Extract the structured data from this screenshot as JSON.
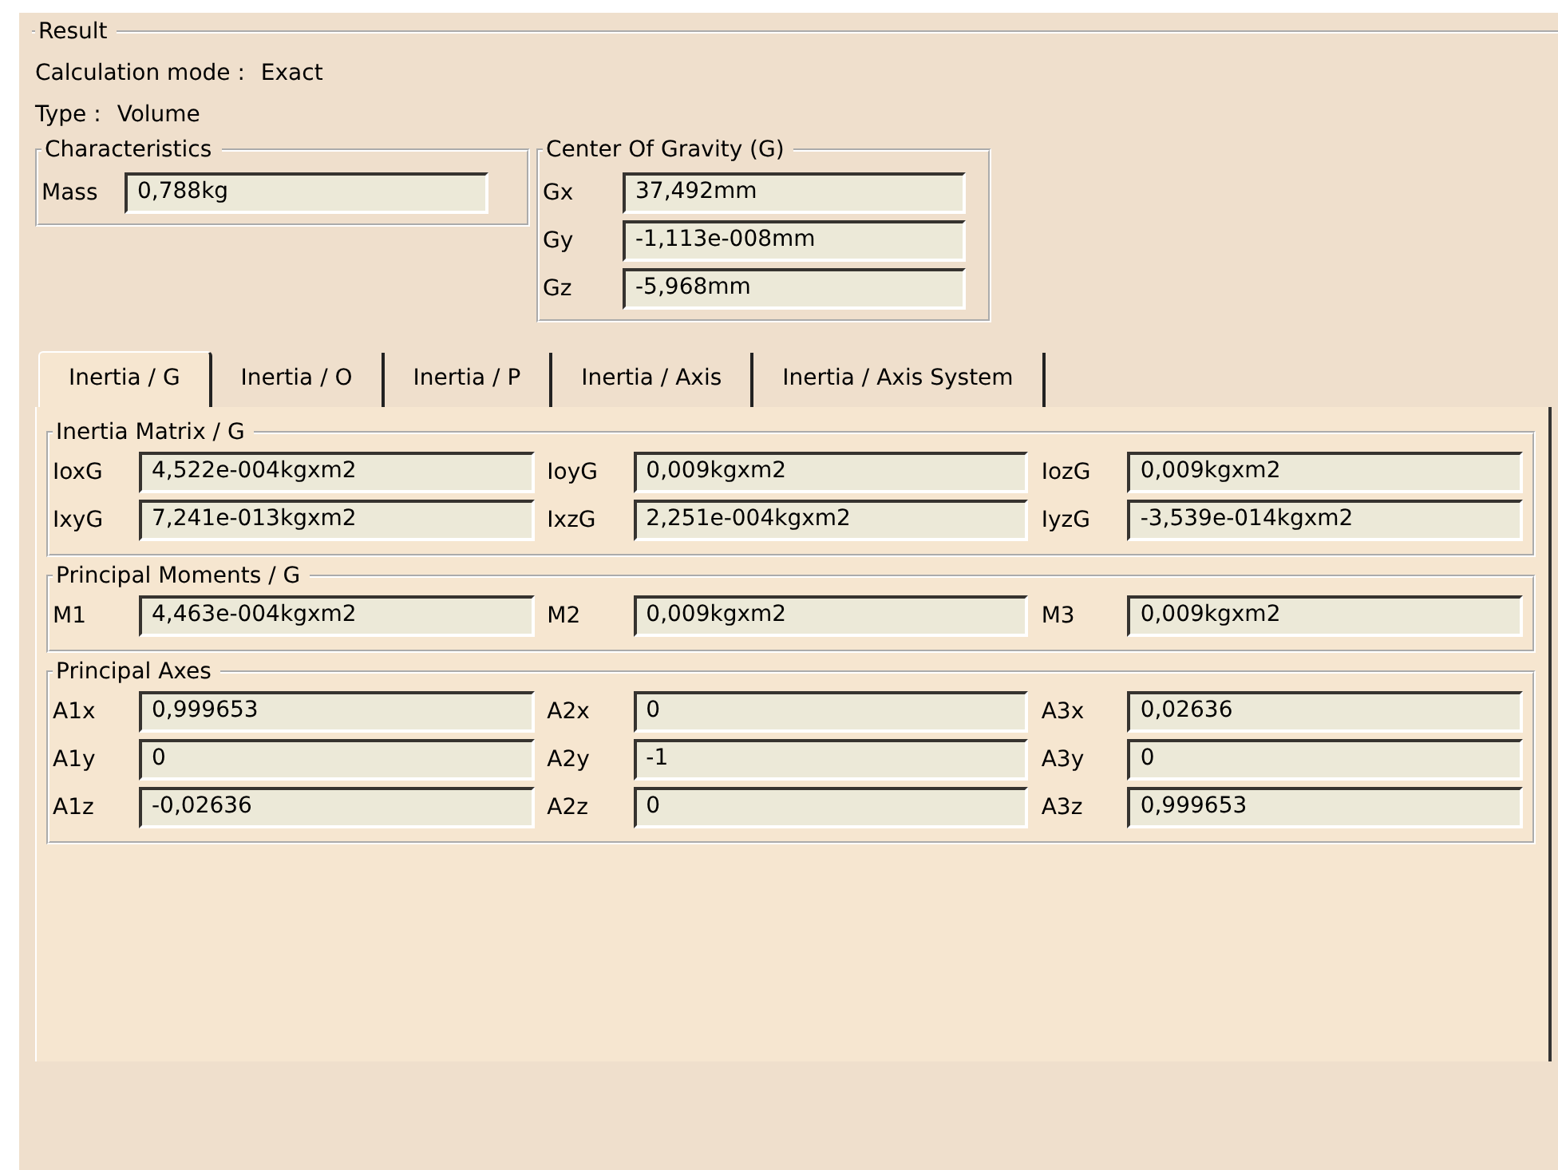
{
  "result": {
    "title": "Result",
    "lines": [
      {
        "label": "Calculation mode :",
        "value": "Exact"
      },
      {
        "label": "Type :",
        "value": "Volume"
      }
    ],
    "characteristics": {
      "title": "Characteristics",
      "fields": [
        {
          "label": "Mass",
          "value": "0,788kg"
        }
      ]
    },
    "center_of_gravity": {
      "title": "Center Of Gravity (G)",
      "fields": [
        {
          "label": "Gx",
          "value": "37,492mm"
        },
        {
          "label": "Gy",
          "value": "-1,113e-008mm"
        },
        {
          "label": "Gz",
          "value": "-5,968mm"
        }
      ]
    }
  },
  "tabs": [
    {
      "label": "Inertia / G",
      "selected": true
    },
    {
      "label": "Inertia / O",
      "selected": false
    },
    {
      "label": "Inertia / P",
      "selected": false
    },
    {
      "label": "Inertia / Axis",
      "selected": false
    },
    {
      "label": "Inertia / Axis System",
      "selected": false
    }
  ],
  "groups": [
    {
      "title": "Inertia Matrix / G",
      "rows": [
        [
          {
            "label": "IoxG",
            "value": "4,522e-004kgxm2"
          },
          {
            "label": "IoyG",
            "value": "0,009kgxm2"
          },
          {
            "label": "IozG",
            "value": "0,009kgxm2"
          }
        ],
        [
          {
            "label": "IxyG",
            "value": "7,241e-013kgxm2"
          },
          {
            "label": "IxzG",
            "value": "2,251e-004kgxm2"
          },
          {
            "label": "IyzG",
            "value": "-3,539e-014kgxm2"
          }
        ]
      ]
    },
    {
      "title": "Principal Moments / G",
      "rows": [
        [
          {
            "label": "M1",
            "value": "4,463e-004kgxm2"
          },
          {
            "label": "M2",
            "value": "0,009kgxm2"
          },
          {
            "label": "M3",
            "value": "0,009kgxm2"
          }
        ]
      ]
    },
    {
      "title": "Principal Axes",
      "rows": [
        [
          {
            "label": "A1x",
            "value": "0,999653"
          },
          {
            "label": "A2x",
            "value": "0"
          },
          {
            "label": "A3x",
            "value": "0,02636"
          }
        ],
        [
          {
            "label": "A1y",
            "value": "0"
          },
          {
            "label": "A2y",
            "value": "-1"
          },
          {
            "label": "A3y",
            "value": "0"
          }
        ],
        [
          {
            "label": "A1z",
            "value": "-0,02636"
          },
          {
            "label": "A2z",
            "value": "0"
          },
          {
            "label": "A3z",
            "value": "0,999653"
          }
        ]
      ]
    }
  ]
}
